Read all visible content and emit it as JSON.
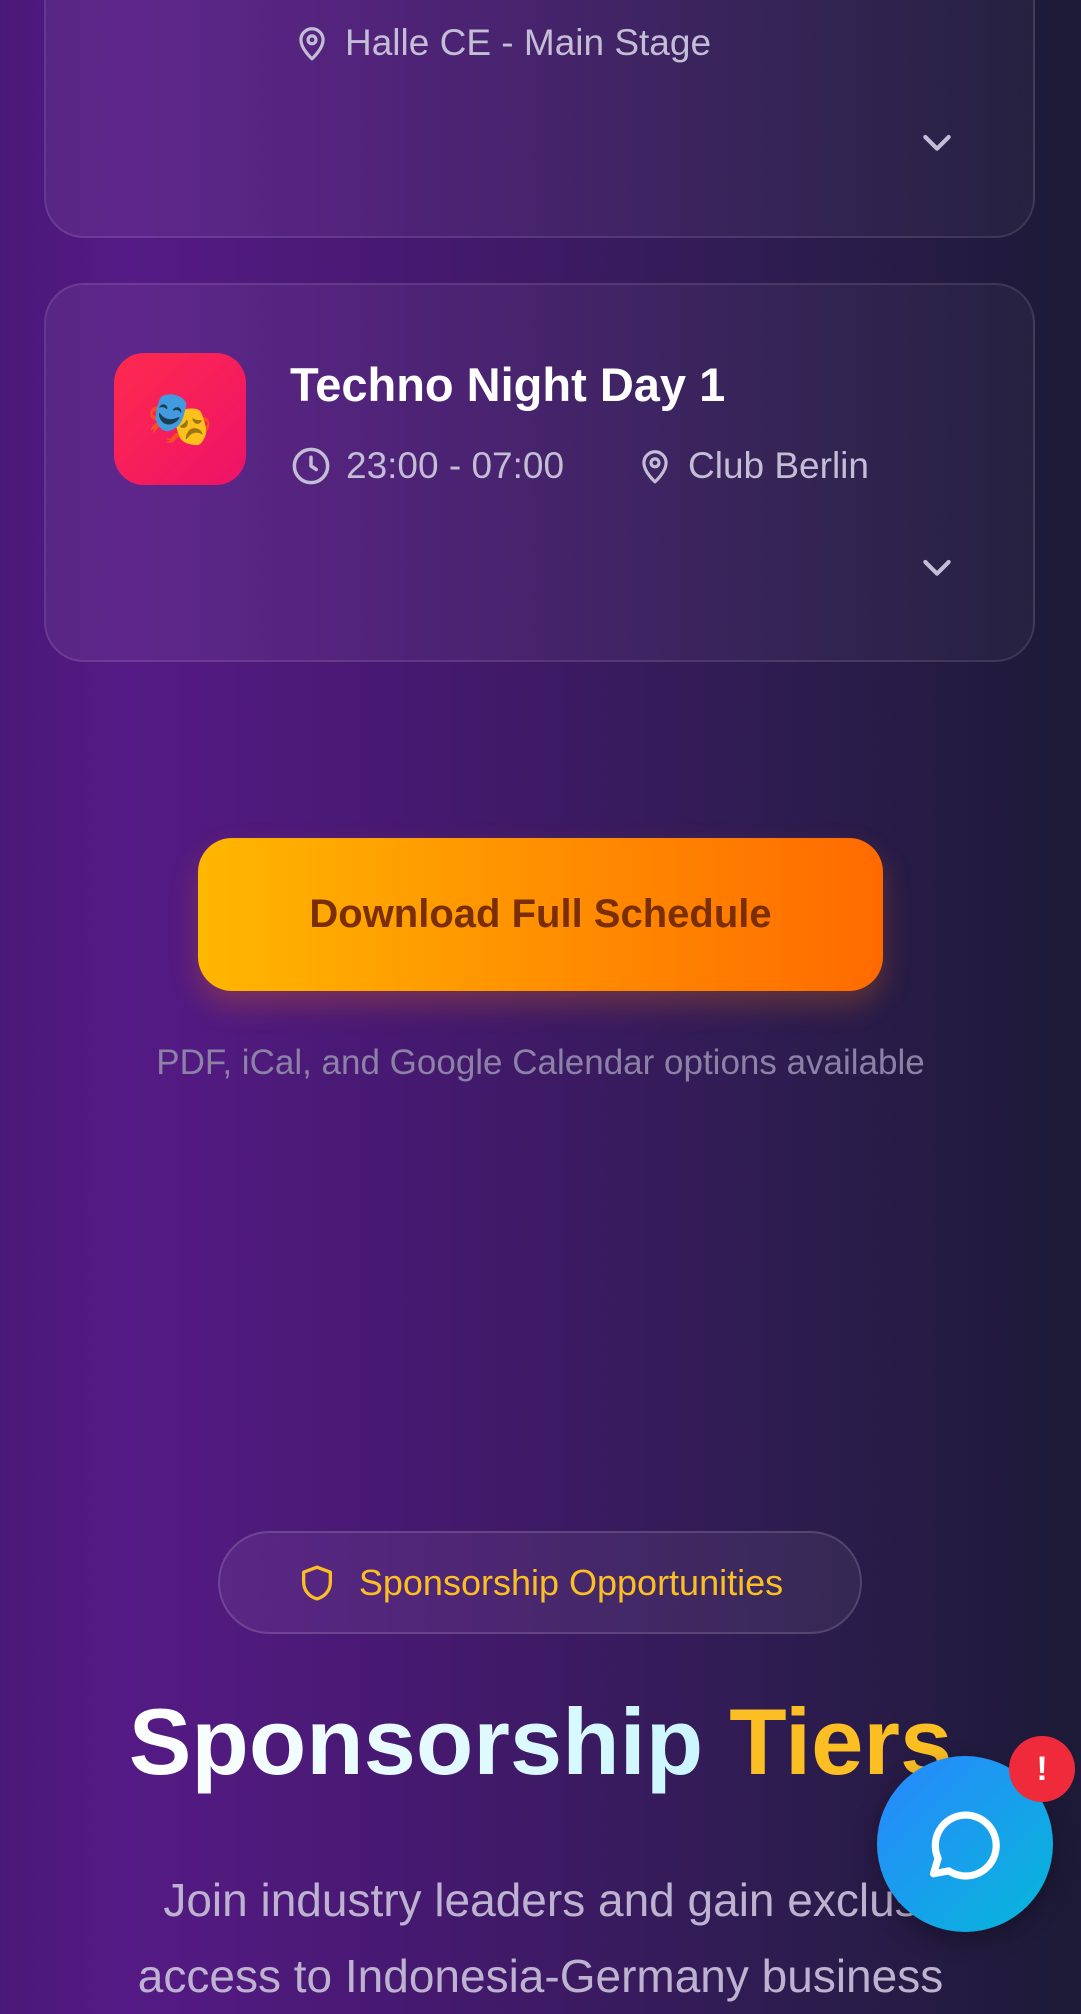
{
  "events": [
    {
      "location": "Halle CE - Main Stage"
    },
    {
      "title": "Techno Night Day 1",
      "time": "23:00 - 07:00",
      "location": "Club Berlin",
      "icon_emoji": "🎭",
      "icon": "theater-masks-icon",
      "icon_bg": "#f0185c"
    }
  ],
  "schedule": {
    "download_label": "Download Full Schedule",
    "note": "PDF, iCal, and Google Calendar options available"
  },
  "sponsorship": {
    "badge_label": "Sponsorship Opportunities",
    "title_part1": "Sponsorship",
    "title_part2": "Tiers",
    "description_line1": "Join industry leaders and gain exclus",
    "description_line2": "access to Indonesia-Germany business"
  },
  "chat": {
    "badge": "!"
  },
  "colors": {
    "accent_yellow": "#fbbf24",
    "button_gradient_start": "#ffb700",
    "button_gradient_end": "#ff6a00",
    "chat_blue": "#2a86ff"
  }
}
